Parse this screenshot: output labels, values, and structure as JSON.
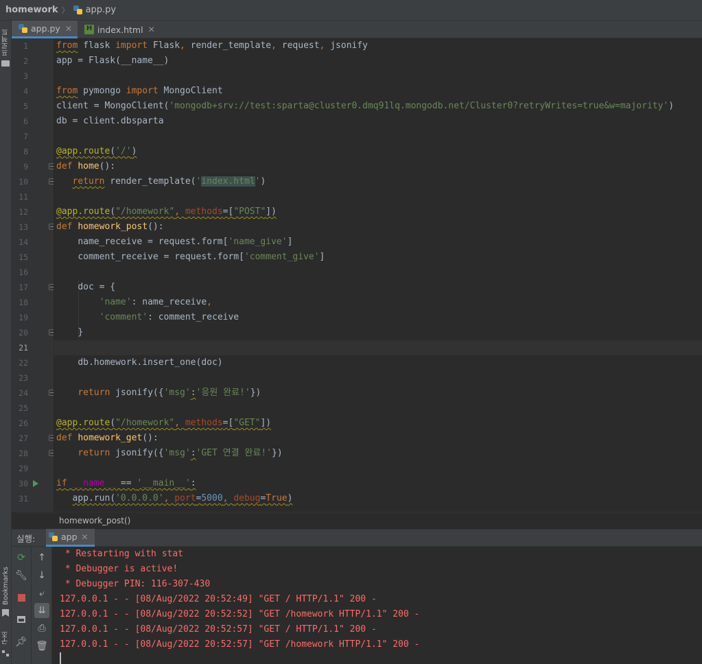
{
  "breadcrumbs": {
    "project": "homework",
    "file": "app.py"
  },
  "left_strip": {
    "project_tab": "프로젝트",
    "bookmarks_tab": "Bookmarks",
    "structure_tab": "구조"
  },
  "tabs": [
    {
      "label": "app.py",
      "icon": "python-file-icon",
      "active": true
    },
    {
      "label": "index.html",
      "icon": "html-file-icon",
      "active": false
    }
  ],
  "editor": {
    "current_line": 21,
    "lines": [
      "1",
      "2",
      "3",
      "4",
      "5",
      "6",
      "7",
      "8",
      "9",
      "10",
      "11",
      "12",
      "13",
      "14",
      "15",
      "16",
      "17",
      "18",
      "19",
      "20",
      "21",
      "22",
      "23",
      "24",
      "25",
      "26",
      "27",
      "28",
      "29",
      "30",
      "31"
    ],
    "code": {
      "l1": [
        "from",
        " flask ",
        "import",
        " Flask",
        ",",
        " render_template",
        ",",
        " request",
        ",",
        " jsonify"
      ],
      "l2": "app = Flask(__name__)",
      "l4": [
        "from",
        " pymongo ",
        "import",
        " MongoClient"
      ],
      "l5": [
        "client = MongoClient(",
        "'mongodb+srv://test:sparta@cluster0.dmq91lq.mongodb.net/Cluster0?retryWrites=true&w=majority'",
        ")"
      ],
      "l6": "db = client.dbsparta",
      "l8": [
        "@app.route",
        "(",
        "'/'",
        ")"
      ],
      "l9": [
        "def",
        " ",
        "home",
        "():"
      ],
      "l10": [
        "return",
        " render_template(",
        "'",
        "index.html",
        "'",
        ")"
      ],
      "l12": [
        "@app.route",
        "(",
        "\"/homework\"",
        ", ",
        "methods",
        "=[",
        "\"POST\"",
        "])"
      ],
      "l13": [
        "def",
        " ",
        "homework_post",
        "():"
      ],
      "l14": [
        "name_receive = request.form[",
        "'name_give'",
        "]"
      ],
      "l15": [
        "comment_receive = request.form[",
        "'comment_give'",
        "]"
      ],
      "l17": "doc = {",
      "l18": [
        "'name'",
        ": name_receive",
        ","
      ],
      "l19": [
        "'comment'",
        ": comment_receive"
      ],
      "l20": "}",
      "l22": "db.homework.insert_one(doc)",
      "l24": [
        "return",
        " jsonify({",
        "'msg'",
        ":",
        "'응원 완료!'",
        "})"
      ],
      "l26": [
        "@app.route",
        "(",
        "\"/homework\"",
        ", ",
        "methods",
        "=[",
        "\"GET\"",
        "])"
      ],
      "l27": [
        "def",
        " ",
        "homework_get",
        "():"
      ],
      "l28": [
        "return",
        " jsonify({",
        "'msg'",
        ":",
        "'GET 연결 완료!'",
        "})"
      ],
      "l30": [
        "if",
        " ",
        "__name__",
        " == ",
        "'__main__'",
        ":"
      ],
      "l31": [
        "app.run(",
        "'0.0.0.0'",
        ", ",
        "port",
        "=",
        "5000",
        ", ",
        "debug",
        "=",
        "True",
        ")"
      ]
    }
  },
  "code_breadcrumb": "homework_post()",
  "run_panel": {
    "label": "실행:",
    "tab_label": "app",
    "output": [
      " * Restarting with stat",
      " * Debugger is active!",
      " * Debugger PIN: 116-307-430",
      "127.0.0.1 - - [08/Aug/2022 20:52:49] \"GET / HTTP/1.1\" 200 -",
      "127.0.0.1 - - [08/Aug/2022 20:52:52] \"GET /homework HTTP/1.1\" 200 -",
      "127.0.0.1 - - [08/Aug/2022 20:52:57] \"GET / HTTP/1.1\" 200 -",
      "127.0.0.1 - - [08/Aug/2022 20:52:57] \"GET /homework HTTP/1.1\" 200 -"
    ]
  },
  "colors": {
    "keyword": "#cc7832",
    "string": "#6a8759",
    "function": "#ffc66d",
    "decorator": "#bbb529",
    "console_text": "#ff6b68",
    "accent": "#4a88c7"
  }
}
